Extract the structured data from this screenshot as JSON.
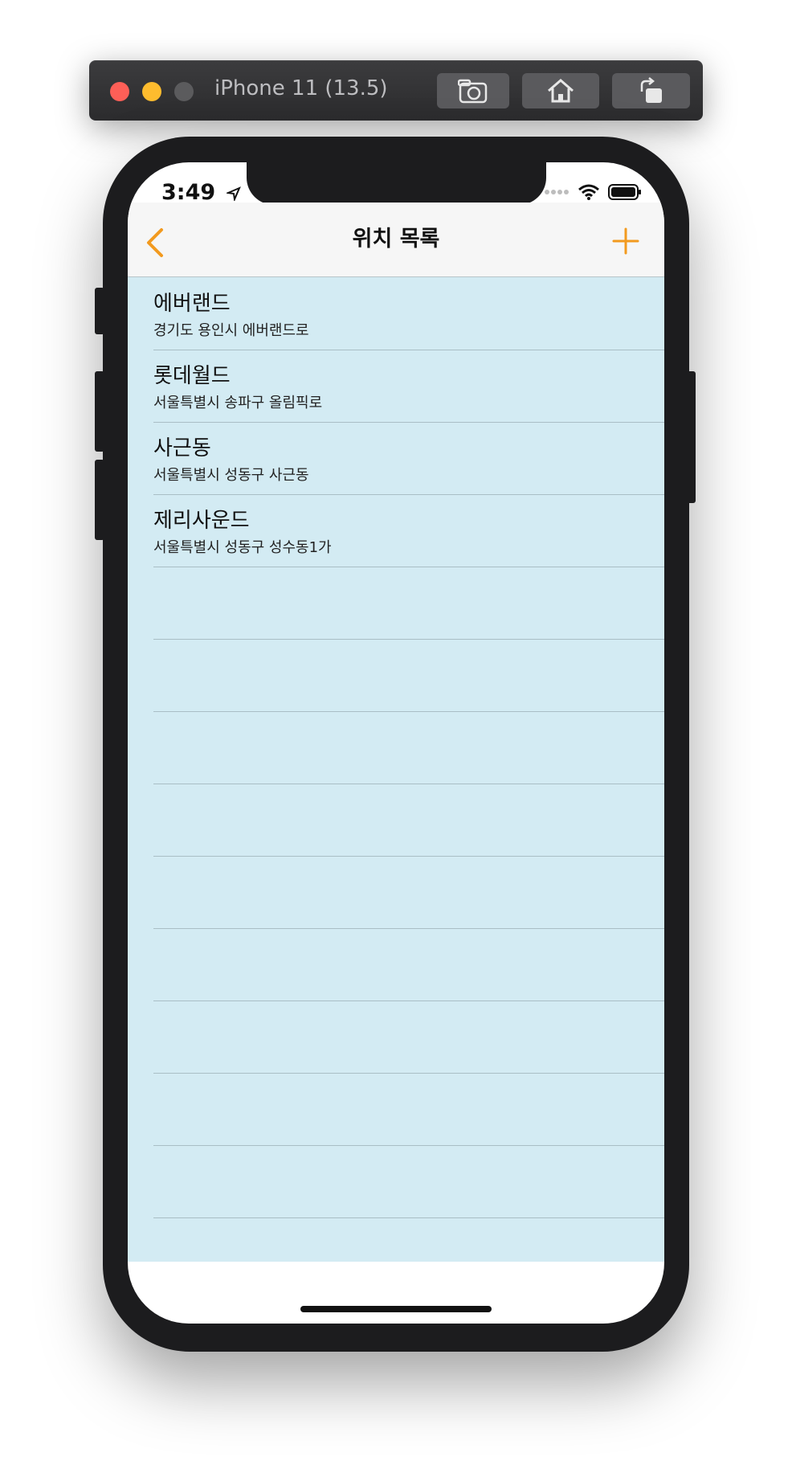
{
  "simulator": {
    "title": "iPhone 11 (13.5)",
    "buttons": [
      "screenshot-icon",
      "home-icon",
      "rotate-icon"
    ]
  },
  "status_bar": {
    "time": "3:49",
    "icons": [
      "location-arrow-icon",
      "signal-icon",
      "wifi-icon",
      "battery-icon"
    ]
  },
  "nav": {
    "title": "위치 목록",
    "back_icon": "chevron-left-icon",
    "add_icon": "plus-icon",
    "accent": "#f29a1f"
  },
  "locations": [
    {
      "name": "에버랜드",
      "address": "경기도 용인시 에버랜드로"
    },
    {
      "name": "롯데월드",
      "address": "서울특별시 송파구 올림픽로"
    },
    {
      "name": "사근동",
      "address": "서울특별시 성동구 사근동"
    },
    {
      "name": "제리사운드",
      "address": "서울특별시 성동구 성수동1가"
    }
  ],
  "list_background": "#d3ebf3"
}
